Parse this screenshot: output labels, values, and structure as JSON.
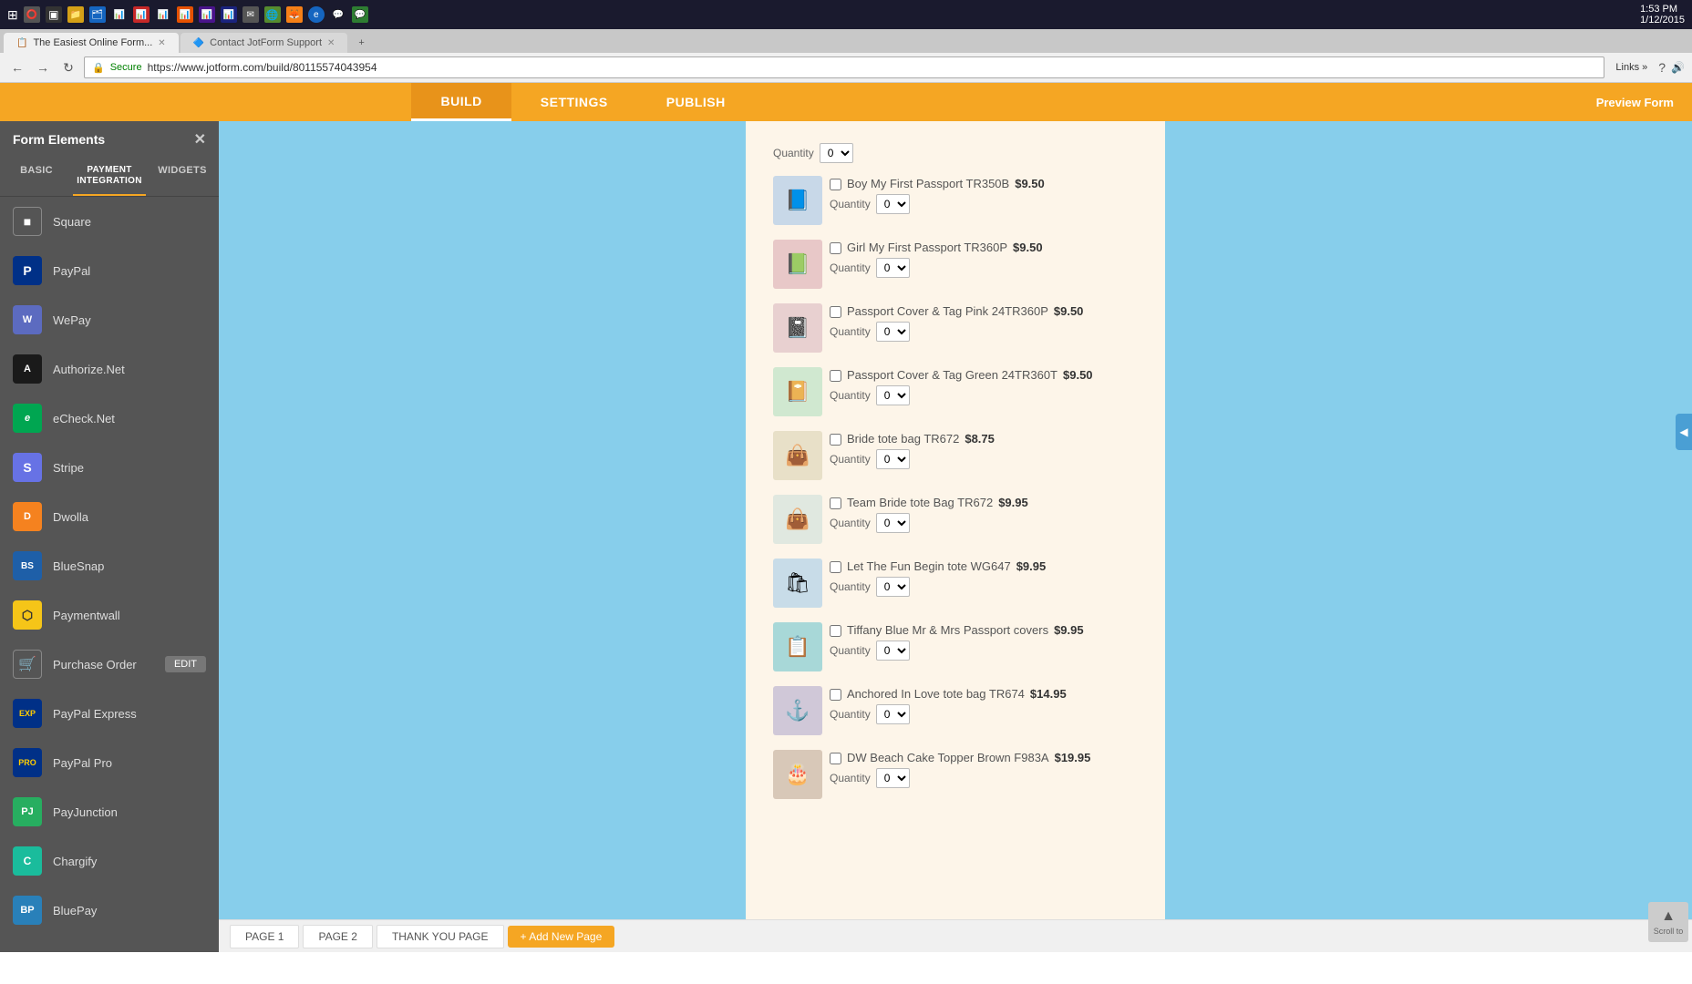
{
  "taskbar": {
    "time": "1:53 PM",
    "date": "1/12/2015"
  },
  "browser": {
    "tab1_label": "The Easiest Online Form...",
    "tab2_label": "Contact JotForm Support",
    "url": "https://www.jotform.com/build/80115574043954",
    "secure_label": "Secure"
  },
  "app_nav": {
    "build_label": "BUILD",
    "settings_label": "SETTINGS",
    "publish_label": "PUBLISH",
    "preview_label": "Preview Form",
    "active_tab": "BUILD"
  },
  "sidebar": {
    "title": "Form Elements",
    "close_icon": "×",
    "tabs": [
      {
        "label": "BASIC",
        "active": false
      },
      {
        "label": "PAYMENT\nINTEGRATION",
        "active": true
      },
      {
        "label": "WIDGETS",
        "active": false
      }
    ],
    "items": [
      {
        "id": "square",
        "label": "Square",
        "icon": "■",
        "icon_class": "icon-square"
      },
      {
        "id": "paypal",
        "label": "PayPal",
        "icon": "P",
        "icon_class": "icon-paypal"
      },
      {
        "id": "wepay",
        "label": "WePay",
        "icon": "W",
        "icon_class": "icon-wepay"
      },
      {
        "id": "authorize",
        "label": "Authorize.Net",
        "icon": "A",
        "icon_class": "icon-authorize"
      },
      {
        "id": "echeck",
        "label": "eCheck.Net",
        "icon": "e",
        "icon_class": "icon-echeck"
      },
      {
        "id": "stripe",
        "label": "Stripe",
        "icon": "S",
        "icon_class": "icon-stripe"
      },
      {
        "id": "dwolla",
        "label": "Dwolla",
        "icon": "D",
        "icon_class": "icon-dwolla"
      },
      {
        "id": "bluesnap",
        "label": "BlueSnap",
        "icon": "BS",
        "icon_class": "icon-bluesnap"
      },
      {
        "id": "paymentwall",
        "label": "Paymentwall",
        "icon": "⬡",
        "icon_class": "icon-paymentwall"
      },
      {
        "id": "purchase",
        "label": "Purchase Order",
        "icon": "🛒",
        "icon_class": "icon-purchase",
        "has_edit": true
      },
      {
        "id": "paypalexpress",
        "label": "PayPal Express",
        "icon": "EXP",
        "icon_class": "icon-paypalexpress"
      },
      {
        "id": "paypalpro",
        "label": "PayPal Pro",
        "icon": "PRO",
        "icon_class": "icon-paypalpro"
      },
      {
        "id": "payjunction",
        "label": "PayJunction",
        "icon": "PJ",
        "icon_class": "icon-payjunction"
      },
      {
        "id": "chargify",
        "label": "Chargify",
        "icon": "C",
        "icon_class": "icon-chargify"
      },
      {
        "id": "bluepay",
        "label": "BluePay",
        "icon": "BP",
        "icon_class": "icon-bluepay"
      }
    ]
  },
  "form": {
    "products": [
      {
        "id": 1,
        "name": "Boy My First Passport TR350B",
        "price": "$9.50",
        "qty_label": "Quantity",
        "qty_value": "0",
        "thumb_emoji": "📘"
      },
      {
        "id": 2,
        "name": "Girl My First Passport TR360P",
        "price": "$9.50",
        "qty_label": "Quantity",
        "qty_value": "0",
        "thumb_emoji": "📗"
      },
      {
        "id": 3,
        "name": "Passport Cover & Tag Pink 24TR360P",
        "price": "$9.50",
        "qty_label": "Quantity",
        "qty_value": "0",
        "thumb_emoji": "📓"
      },
      {
        "id": 4,
        "name": "Passport Cover & Tag Green 24TR360T",
        "price": "$9.50",
        "qty_label": "Quantity",
        "qty_value": "0",
        "thumb_emoji": "📔"
      },
      {
        "id": 5,
        "name": "Bride tote bag TR672",
        "price": "$8.75",
        "qty_label": "Quantity",
        "qty_value": "0",
        "thumb_emoji": "👜"
      },
      {
        "id": 6,
        "name": "Team Bride tote Bag TR672",
        "price": "$9.95",
        "qty_label": "Quantity",
        "qty_value": "0",
        "thumb_emoji": "👜"
      },
      {
        "id": 7,
        "name": "Let The Fun Begin tote WG647",
        "price": "$9.95",
        "qty_label": "Quantity",
        "qty_value": "0",
        "thumb_emoji": "🛍"
      },
      {
        "id": 8,
        "name": "Tiffany Blue Mr & Mrs Passport covers",
        "price": "$9.95",
        "qty_label": "Quantity",
        "qty_value": "0",
        "thumb_emoji": "📋"
      },
      {
        "id": 9,
        "name": "Anchored In Love tote bag TR674",
        "price": "$14.95",
        "qty_label": "Quantity",
        "qty_value": "0",
        "thumb_emoji": "⚓"
      },
      {
        "id": 10,
        "name": "DW Beach Cake Topper Brown F983A",
        "price": "$19.95",
        "qty_label": "Quantity",
        "qty_value": "0",
        "thumb_emoji": "🎂"
      }
    ],
    "top_qty_label": "Quantity",
    "top_qty_value": "0"
  },
  "pages": {
    "page1_label": "PAGE 1",
    "page2_label": "PAGE 2",
    "thankyou_label": "THANK YOU PAGE",
    "add_page_label": "+ Add New Page"
  },
  "scroll_top": {
    "icon": "▲",
    "label": "Scroll to"
  }
}
